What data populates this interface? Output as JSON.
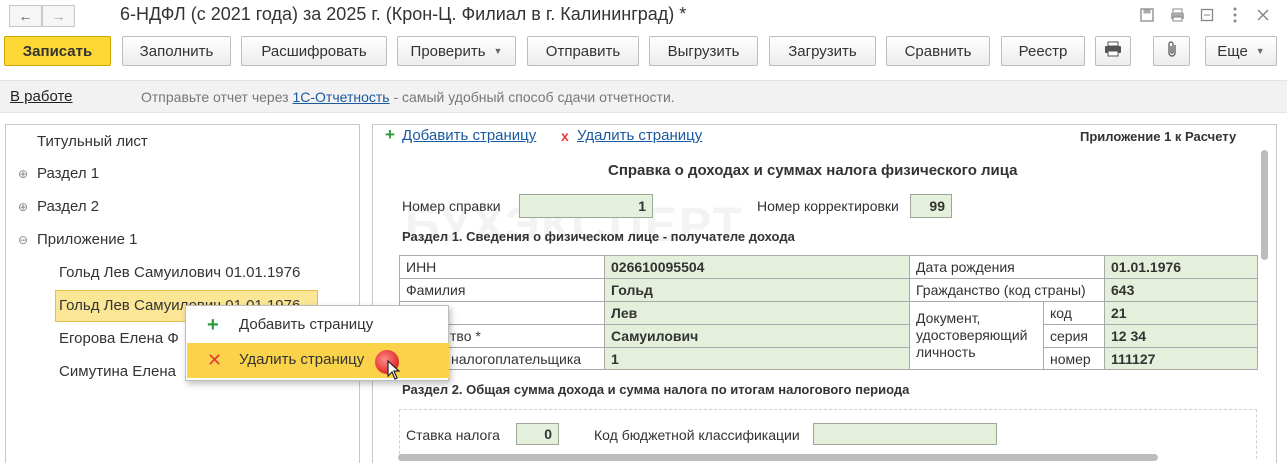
{
  "window": {
    "title": "6-НДФЛ (с 2021 года) за 2025 г. (Крон-Ц. Филиал в г. Калининград) *",
    "back_icon": "←",
    "forward_icon": "→",
    "icons": [
      "save-icon",
      "print-icon",
      "restore-icon",
      "more-vertical-icon",
      "close-icon"
    ]
  },
  "toolbar": {
    "save": "Записать",
    "fill": "Заполнить",
    "decode": "Расшифровать",
    "check": "Проверить",
    "send": "Отправить",
    "export": "Выгрузить",
    "import": "Загрузить",
    "compare": "Сравнить",
    "registry": "Реестр",
    "more": "Еще"
  },
  "info": {
    "status": "В работе",
    "text_before": "Отправьте отчет через ",
    "link": "1С-Отчетность",
    "text_after": " - самый удобный способ сдачи отчетности."
  },
  "tree": {
    "title_page": "Титульный лист",
    "section1": "Раздел 1",
    "section2": "Раздел 2",
    "appendix1": "Приложение 1",
    "child1": "Гольд Лев Самуилович 01.01.1976",
    "child2": "Гольд Лев Самуилович 01.01.1976",
    "child3": "Егорова Елена Ф",
    "child4": "Симутина Елена"
  },
  "context_menu": {
    "add": "Добавить страницу",
    "delete": "Удалить страницу"
  },
  "form": {
    "add_page": "Добавить страницу",
    "delete_page": "Удалить страницу",
    "appendix_label": "Приложение 1 к Расчету",
    "heading": "Справка о доходах и суммах налога физического лица",
    "cert_number_label": "Номер справки",
    "cert_number": "1",
    "correction_label": "Номер корректировки",
    "correction": "99",
    "section1_title": "Раздел 1. Сведения о физическом лице - получателе дохода",
    "inn_label": "ИНН",
    "inn": "026610095504",
    "birth_label": "Дата рождения",
    "birth": "01.01.1976",
    "surname_label": "Фамилия",
    "surname": "Гольд",
    "citizenship_label": "Гражданство (код страны)",
    "citizenship": "643",
    "name": "Лев",
    "doc_label": "Документ, удостоверяющий личность",
    "code_label": "код",
    "code": "21",
    "patronymic_label": "тво *",
    "patronymic": "Самуилович",
    "series_label": "серия",
    "series": "12 34",
    "status_label": "налогоплательщика",
    "status": "1",
    "number_label": "номер",
    "number": "111127",
    "section2_title": "Раздел 2. Общая сумма дохода и сумма налога по итогам налогового периода",
    "rate_label": "Ставка налога",
    "rate": "0",
    "kbk_label": "Код бюджетной классификации",
    "kbk": ""
  },
  "watermark": "БУХЭКСПЕРТ",
  "colors": {
    "primary_button": "#fdd835",
    "selection": "#fbe696",
    "menu_highlight": "#fbd34a",
    "field_fill": "#e4f0dc",
    "link": "#1a5aa0",
    "add_icon": "#2e9a3a",
    "delete_icon": "#e53935"
  }
}
